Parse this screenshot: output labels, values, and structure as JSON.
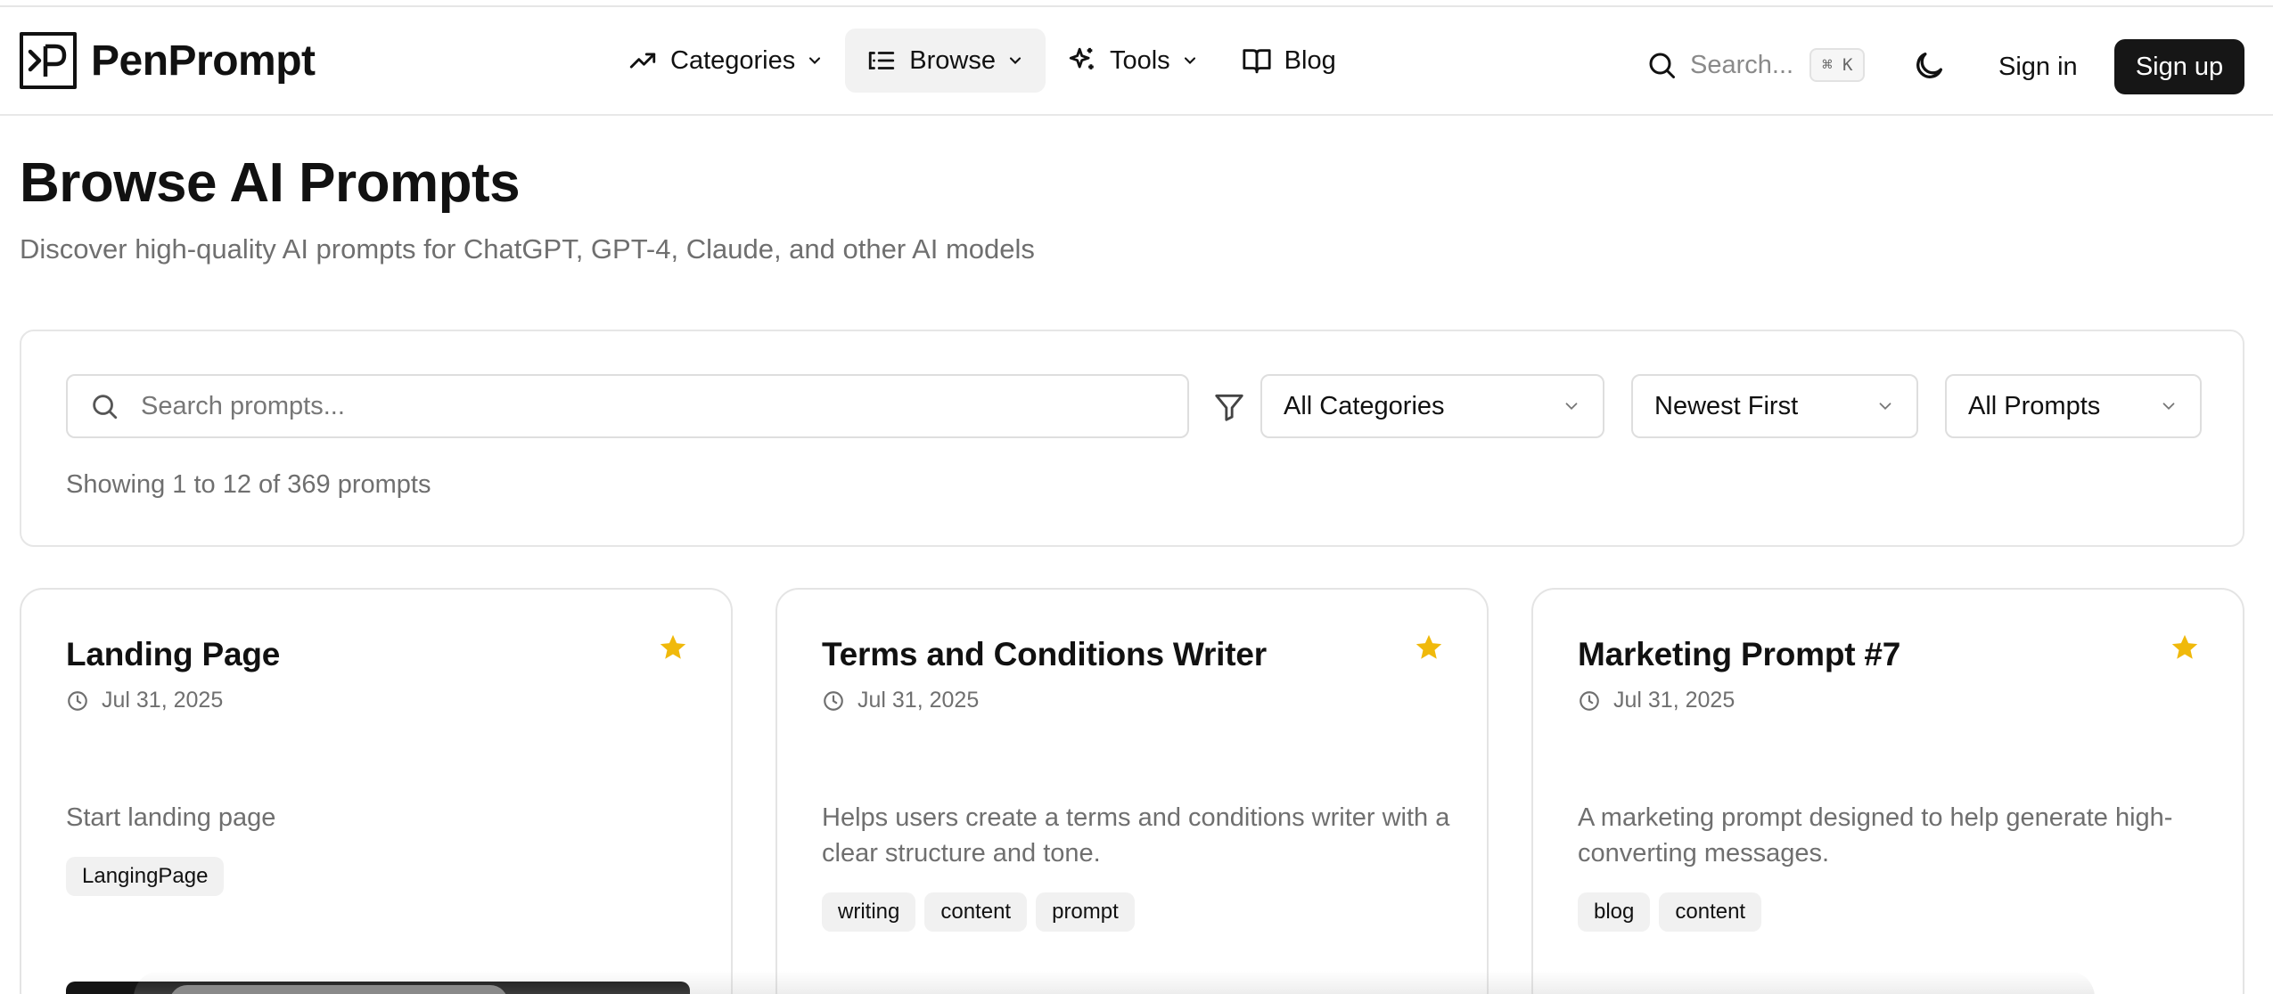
{
  "brand": {
    "name": "PenPrompt"
  },
  "nav": [
    {
      "label": "Categories",
      "icon": "trending-up-icon",
      "dropdown": true
    },
    {
      "label": "Browse",
      "icon": "list-icon",
      "dropdown": true,
      "active": true
    },
    {
      "label": "Tools",
      "icon": "sparkles-icon",
      "dropdown": true
    },
    {
      "label": "Blog",
      "icon": "book-open-icon",
      "dropdown": false
    }
  ],
  "header": {
    "search_placeholder": "Search...",
    "search_shortcut": "⌘ K",
    "theme_icon": "moon-icon",
    "signin_label": "Sign in",
    "signup_label": "Sign up"
  },
  "page": {
    "title": "Browse AI Prompts",
    "subtitle": "Discover high-quality AI prompts for ChatGPT, GPT-4, Claude, and other AI models"
  },
  "filters": {
    "search_placeholder": "Search prompts...",
    "category": "All Categories",
    "sort": "Newest First",
    "type": "All Prompts",
    "results_text": "Showing 1 to 12 of 369 prompts"
  },
  "cards": [
    {
      "title": "Landing Page",
      "date": "Jul 31, 2025",
      "description": "Start landing page",
      "tags": [
        "LangingPage"
      ],
      "featured": true
    },
    {
      "title": "Terms and Conditions Writer",
      "date": "Jul 31, 2025",
      "description": "Helps users create a terms and conditions writer with a clear structure and tone.",
      "tags": [
        "writing",
        "content",
        "prompt"
      ],
      "featured": true
    },
    {
      "title": "Marketing Prompt #7",
      "date": "Jul 31, 2025",
      "description": "A marketing prompt designed to help generate high-converting messages.",
      "tags": [
        "blog",
        "content"
      ],
      "featured": true
    }
  ],
  "colors": {
    "accent_dark": "#161616",
    "star": "#f0b90b",
    "muted_text": "#6f6f6f",
    "border": "#e4e4e4"
  }
}
